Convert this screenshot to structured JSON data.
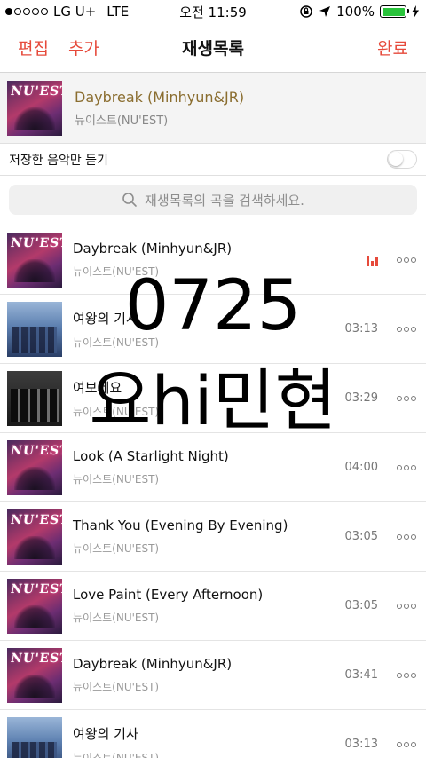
{
  "status_bar": {
    "carrier": "LG U+",
    "network": "LTE",
    "time": "오전 11:59",
    "battery_percent": "100%",
    "signal_bars_filled": 1,
    "signal_bars_total": 5,
    "icons": [
      "signal-icon",
      "orientation-lock-icon",
      "location-icon",
      "battery-icon",
      "charging-icon"
    ],
    "battery_color": "#29c33b"
  },
  "nav": {
    "edit_label": "편집",
    "add_label": "추가",
    "title": "재생목록",
    "done_label": "완료",
    "accent_color": "#e64a3b"
  },
  "now_playing": {
    "title": "Daybreak (Minhyun&JR)",
    "artist": "뉴이스트(NU'EST)",
    "art_text": "NU'EST",
    "title_color": "#8a6d2f"
  },
  "saved_only": {
    "label": "저장한 음악만 듣기",
    "enabled": false
  },
  "search": {
    "placeholder": "재생목록의 곡을 검색하세요."
  },
  "tracks": [
    {
      "title": "Daybreak (Minhyun&JR)",
      "artist": "뉴이스트(NU'EST)",
      "duration": "",
      "playing": true,
      "art": "nuest"
    },
    {
      "title": "여왕의 기사",
      "artist": "뉴이스트(NU'EST)",
      "duration": "03:13",
      "playing": false,
      "art": "knight"
    },
    {
      "title": "여보세요",
      "artist": "뉴이스트(NU'EST)",
      "duration": "03:29",
      "playing": false,
      "art": "group"
    },
    {
      "title": "Look (A Starlight Night)",
      "artist": "뉴이스트(NU'EST)",
      "duration": "04:00",
      "playing": false,
      "art": "nuest"
    },
    {
      "title": "Thank You (Evening By Evening)",
      "artist": "뉴이스트(NU'EST)",
      "duration": "03:05",
      "playing": false,
      "art": "nuest"
    },
    {
      "title": "Love Paint (Every Afternoon)",
      "artist": "뉴이스트(NU'EST)",
      "duration": "03:05",
      "playing": false,
      "art": "nuest"
    },
    {
      "title": "Daybreak (Minhyun&JR)",
      "artist": "뉴이스트(NU'EST)",
      "duration": "03:41",
      "playing": false,
      "art": "nuest"
    },
    {
      "title": "여왕의 기사",
      "artist": "뉴이스트(NU'EST)",
      "duration": "03:13",
      "playing": false,
      "art": "knight"
    }
  ],
  "overlay_text": {
    "line1": "0725",
    "line2": "요hi민현"
  }
}
